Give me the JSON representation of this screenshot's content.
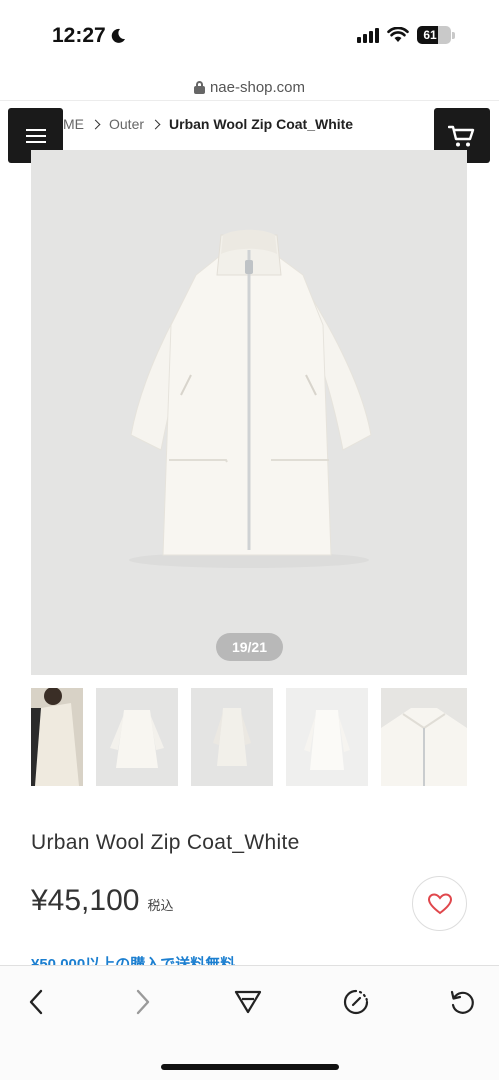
{
  "status_bar": {
    "time": "12:27",
    "battery_level": "61",
    "battery_fraction": 0.61
  },
  "browser": {
    "url": "nae-shop.com"
  },
  "header": {
    "menu_icon": "hamburger-icon",
    "cart_icon": "cart-icon"
  },
  "breadcrumb": {
    "items": [
      "ME",
      "Outer"
    ],
    "current": "Urban Wool Zip Coat_White"
  },
  "gallery": {
    "counter": "19/21",
    "thumbnail_count": 5
  },
  "product": {
    "name": "Urban Wool Zip Coat_White",
    "price": "¥45,100",
    "tax_label": "税込",
    "shipping_note": "¥50,000以上の購入で送料無料",
    "favorite_icon": "heart-icon"
  },
  "toolbar": {
    "icons": [
      "back-icon",
      "forward-icon",
      "share-icon",
      "timer-icon",
      "reload-icon"
    ]
  },
  "colors": {
    "accent_blue": "#1c7fd0",
    "heart_red": "#e0474c",
    "header_dark": "#1a1a1a"
  }
}
